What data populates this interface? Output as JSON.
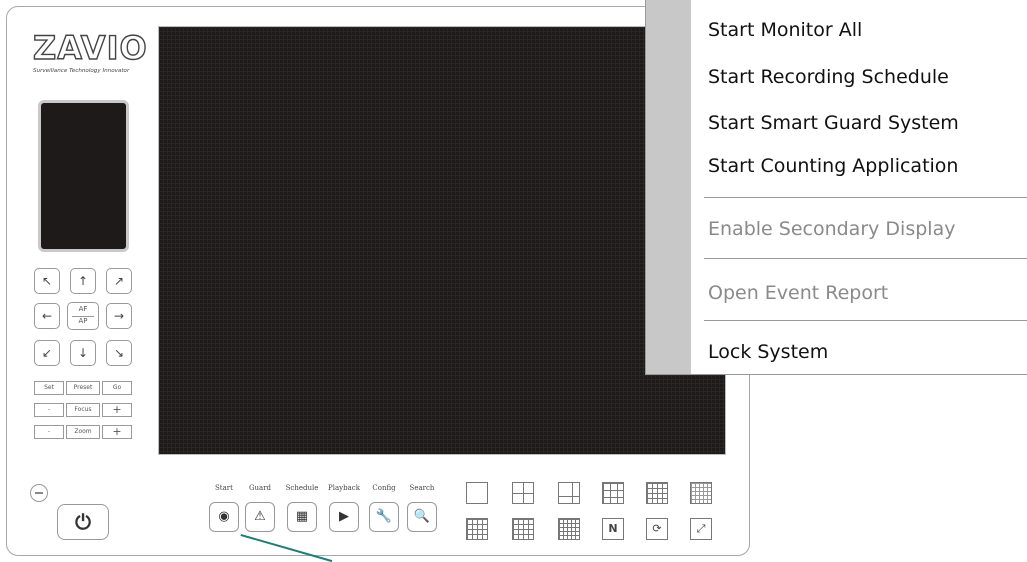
{
  "brand": {
    "logo": "ZAVIO",
    "tagline": "Surveillance Technology Innovator"
  },
  "ptz": {
    "arrows": [
      "↖",
      "↑",
      "↗",
      "←",
      "→",
      "↙",
      "↓",
      "↘"
    ],
    "af_label": "AF",
    "ap_label": "AP",
    "preset_row": [
      "Set",
      "Preset",
      "Go"
    ],
    "focus_row": [
      "-",
      "Focus",
      "+"
    ],
    "zoom_row": [
      "-",
      "Zoom",
      "+"
    ]
  },
  "power": {
    "icon": "power-icon",
    "glyph": "⏻"
  },
  "functions": [
    {
      "label": "Start",
      "icon": "record-icon",
      "glyph": "◉"
    },
    {
      "label": "Guard",
      "icon": "warning-icon",
      "glyph": "⚠"
    },
    {
      "label": "Schedule",
      "icon": "schedule-icon",
      "glyph": "▦"
    },
    {
      "label": "Playback",
      "icon": "play-icon",
      "glyph": "▶"
    },
    {
      "label": "Config",
      "icon": "wrench-icon",
      "glyph": "🔧"
    },
    {
      "label": "Search",
      "icon": "search-icon",
      "glyph": "🔍"
    }
  ],
  "layouts": [
    {
      "icon": "layout-1-icon",
      "glyph": ""
    },
    {
      "icon": "layout-4-icon",
      "glyph": ""
    },
    {
      "icon": "layout-6-icon",
      "glyph": ""
    },
    {
      "icon": "layout-9-icon",
      "glyph": ""
    },
    {
      "icon": "layout-13-icon",
      "glyph": ""
    },
    {
      "icon": "layout-16-icon",
      "glyph": ""
    },
    {
      "icon": "layout-8-icon",
      "glyph": ""
    },
    {
      "icon": "layout-10-icon",
      "glyph": ""
    },
    {
      "icon": "layout-25-icon",
      "glyph": ""
    },
    {
      "icon": "sequence-icon",
      "glyph": "N"
    },
    {
      "icon": "rotate-icon",
      "glyph": "⟳"
    },
    {
      "icon": "fullscreen-icon",
      "glyph": "⤢"
    }
  ],
  "context_menu": {
    "items": [
      {
        "label": "Start Monitor All",
        "enabled": true
      },
      {
        "label": "Start Recording Schedule",
        "enabled": true
      },
      {
        "label": "Start Smart Guard System",
        "enabled": true
      },
      {
        "label": "Start Counting Application",
        "enabled": true
      },
      {
        "label": "Enable Secondary Display",
        "enabled": false
      },
      {
        "label": "Open Event Report",
        "enabled": false
      },
      {
        "label": "Lock System",
        "enabled": true
      }
    ]
  },
  "colors": {
    "pointer": "#1b8078",
    "video_bg": "#1e1a1a",
    "menu_strip": "#c8c8c8"
  }
}
